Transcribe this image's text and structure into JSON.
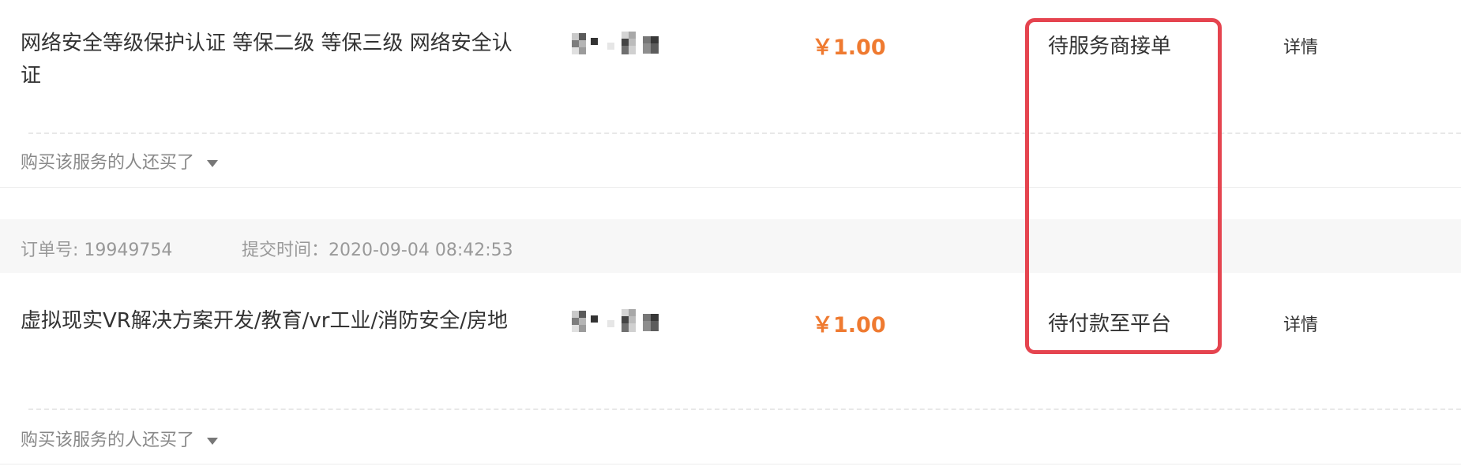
{
  "orders": [
    {
      "service_name": "网络安全等级保护认证 等保二级 等保三级 网络安全认证",
      "price": "￥1.00",
      "status": "待服务商接单",
      "detail": "详情",
      "also_bought": "购买该服务的人还买了"
    },
    {
      "order_no_label": "订单号: 19949754",
      "submit_time_label": "提交时间：2020-09-04 08:42:53",
      "service_name": "虚拟现实VR解决方案开发/教育/vr工业/消防安全/房地",
      "price": "￥1.00",
      "status": "待付款至平台",
      "detail": "详情",
      "also_bought": "购买该服务的人还买了"
    }
  ],
  "colors": {
    "price": "#ef7a30",
    "highlight_border": "#e5444f",
    "header_bg": "#f7f7f7"
  }
}
